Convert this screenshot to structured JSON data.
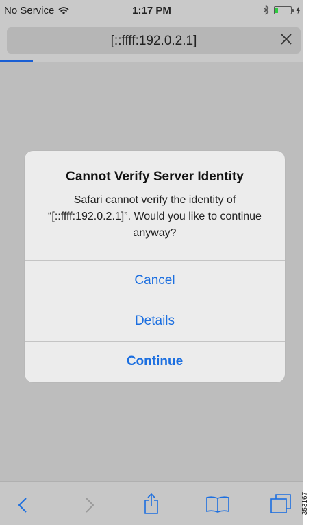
{
  "status_bar": {
    "carrier": "No Service",
    "time": "1:17 PM"
  },
  "url_bar": {
    "url": "[::ffff:192.0.2.1]"
  },
  "alert": {
    "title": "Cannot Verify Server Identity",
    "message": "Safari cannot verify the identity of “[::ffff:192.0.2.1]”. Would you like to continue anyway?",
    "buttons": {
      "cancel": "Cancel",
      "details": "Details",
      "continue": "Continue"
    }
  },
  "toolbar": {
    "icons": [
      "back-icon",
      "forward-icon",
      "share-icon",
      "bookmarks-icon",
      "tabs-icon"
    ]
  },
  "figure_id": "353167",
  "colors": {
    "accent": "#1c6fe0",
    "overlay": "#bdbdbd",
    "alert_bg": "#ececec",
    "progress": "#1a5fd4",
    "battery": "#2ecc40"
  }
}
